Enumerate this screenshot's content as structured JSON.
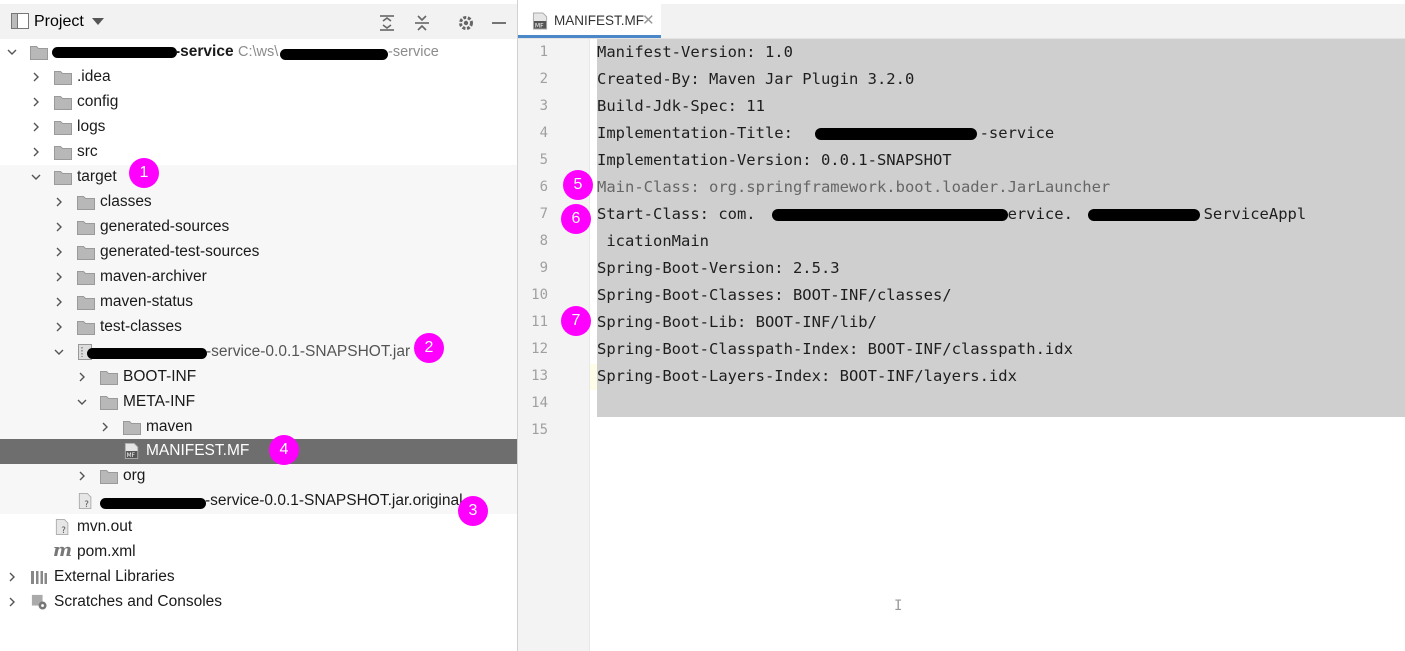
{
  "project_panel": {
    "title": "Project",
    "tree": [
      {
        "id": "root",
        "label": "-service",
        "path": "C:\\ws\\",
        "path_suffix": "-service"
      },
      {
        "id": "idea",
        "label": ".idea"
      },
      {
        "id": "config",
        "label": "config"
      },
      {
        "id": "logs",
        "label": "logs"
      },
      {
        "id": "src",
        "label": "src"
      },
      {
        "id": "target",
        "label": "target"
      },
      {
        "id": "classes",
        "label": "classes"
      },
      {
        "id": "generated-sources",
        "label": "generated-sources"
      },
      {
        "id": "generated-test-sources",
        "label": "generated-test-sources"
      },
      {
        "id": "maven-archiver",
        "label": "maven-archiver"
      },
      {
        "id": "maven-status",
        "label": "maven-status"
      },
      {
        "id": "test-classes",
        "label": "test-classes"
      },
      {
        "id": "jar",
        "label": "-service-0.0.1-SNAPSHOT.jar"
      },
      {
        "id": "boot-inf",
        "label": "BOOT-INF"
      },
      {
        "id": "meta-inf",
        "label": "META-INF"
      },
      {
        "id": "maven",
        "label": "maven"
      },
      {
        "id": "manifest",
        "label": "MANIFEST.MF"
      },
      {
        "id": "org",
        "label": "org"
      },
      {
        "id": "jar-original",
        "label": "-service-0.0.1-SNAPSHOT.jar.original"
      },
      {
        "id": "mvn-out",
        "label": "mvn.out"
      },
      {
        "id": "pom",
        "label": "pom.xml"
      },
      {
        "id": "ext-libs",
        "label": "External Libraries"
      },
      {
        "id": "scratches",
        "label": "Scratches and Consoles"
      }
    ]
  },
  "badges": [
    "1",
    "2",
    "3",
    "4",
    "5",
    "6",
    "7"
  ],
  "editor": {
    "tab_label": "MANIFEST.MF",
    "tab_close": "✕",
    "line_numbers": [
      "1",
      "2",
      "3",
      "4",
      "5",
      "6",
      "7",
      "8",
      "9",
      "10",
      "11",
      "12",
      "13",
      "14",
      "15"
    ],
    "lines": [
      "Manifest-Version: 1.0",
      "Created-By: Maven Jar Plugin 3.2.0",
      "Build-Jdk-Spec: 11",
      "Implementation-Title:                    -service",
      "Implementation-Version: 0.0.1-SNAPSHOT",
      "Main-Class: org.springframework.boot.loader.JarLauncher",
      "Start-Class: com.                          service.              ServiceAppl",
      " icationMain",
      "Spring-Boot-Version: 2.5.3",
      "Spring-Boot-Classes: BOOT-INF/classes/",
      "Spring-Boot-Lib: BOOT-INF/lib/",
      "Spring-Boot-Classpath-Index: BOOT-INF/classpath.idx",
      "Spring-Boot-Layers-Index: BOOT-INF/layers.idx"
    ],
    "cursor": "I"
  },
  "colors": {
    "badge": "#ff00ff",
    "selection": "#6e6e6e",
    "code_selection": "#cfcfcf",
    "tab_underline": "#4a88c7"
  },
  "icons": [
    "project-view-icon",
    "dropdown-arrow-icon",
    "expand-all-icon",
    "collapse-all-icon",
    "settings-gear-icon",
    "hide-minus-icon",
    "folder-icon",
    "chevron-right-icon",
    "chevron-down-icon",
    "jar-icon",
    "manifest-file-icon",
    "unknown-file-icon",
    "maven-icon",
    "library-icon",
    "scratches-icon"
  ]
}
